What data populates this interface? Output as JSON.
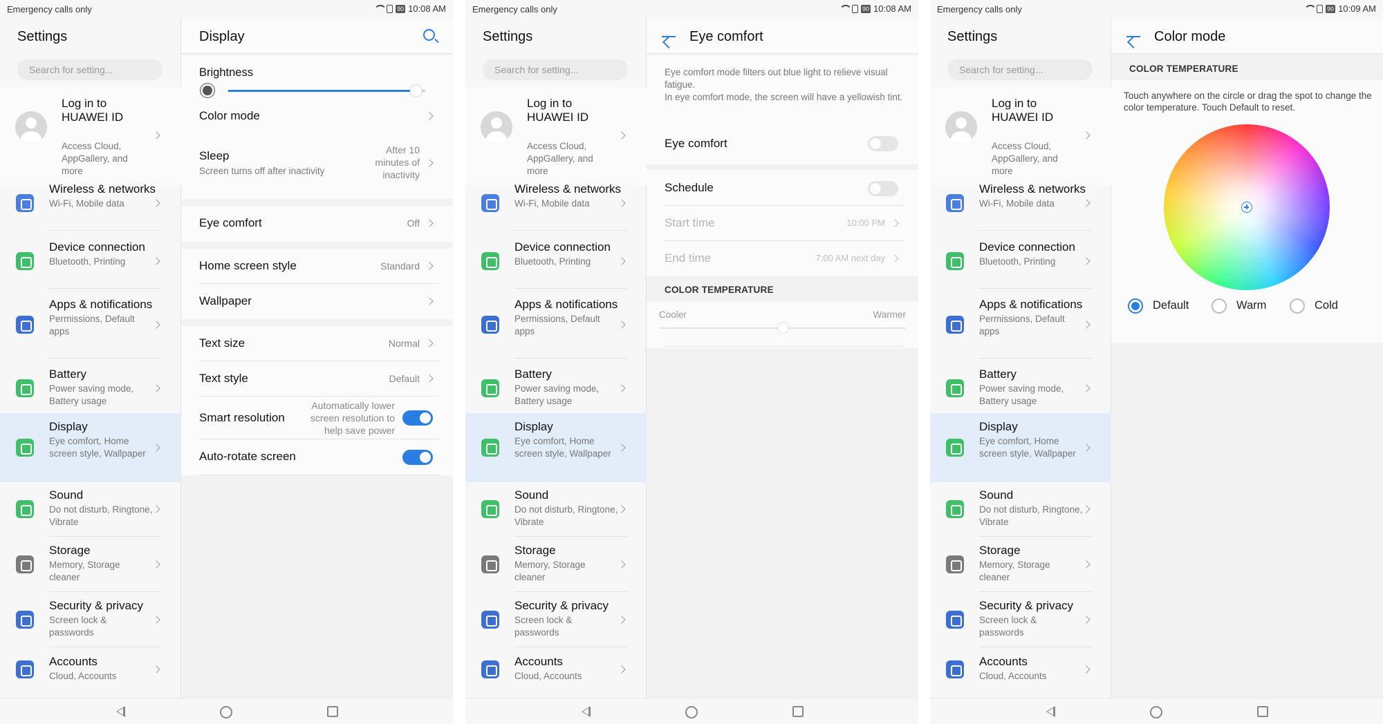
{
  "status": {
    "carrier": "Emergency calls only",
    "battery": "90",
    "time1": "10:08 AM",
    "time2": "10:08 AM",
    "time3": "10:09 AM"
  },
  "nav": {
    "title": "Settings",
    "search_placeholder": "Search for setting...",
    "login_title": "Log in to HUAWEI ID",
    "login_sub": "Access Cloud, AppGallery, and more",
    "items": [
      {
        "title": "Wireless & networks",
        "sub": "Wi-Fi, Mobile data",
        "icon": "wifi-icon"
      },
      {
        "title": "Device connection",
        "sub": "Bluetooth, Printing",
        "icon": "device-connection-icon"
      },
      {
        "title": "Apps & notifications",
        "sub": "Permissions, Default apps",
        "icon": "apps-icon"
      },
      {
        "title": "Battery",
        "sub": "Power saving mode, Battery usage",
        "icon": "battery-icon"
      },
      {
        "title": "Display",
        "sub": "Eye comfort, Home screen style, Wallpaper",
        "icon": "display-icon"
      },
      {
        "title": "Sound",
        "sub": "Do not disturb, Ringtone, Vibrate",
        "icon": "sound-icon"
      },
      {
        "title": "Storage",
        "sub": "Memory, Storage cleaner",
        "icon": "storage-icon"
      },
      {
        "title": "Security & privacy",
        "sub": "Screen lock & passwords",
        "icon": "shield-icon"
      },
      {
        "title": "Accounts",
        "sub": "Cloud, Accounts",
        "icon": "accounts-icon"
      }
    ]
  },
  "display": {
    "title": "Display",
    "brightness": "Brightness",
    "brightness_level": 0.95,
    "color_mode": "Color mode",
    "sleep": "Sleep",
    "sleep_sub": "Screen turns off after inactivity",
    "sleep_value": "After 10 minutes of inactivity",
    "eye_comfort": "Eye comfort",
    "eye_comfort_value": "Off",
    "home_screen_style": "Home screen style",
    "home_screen_style_value": "Standard",
    "wallpaper": "Wallpaper",
    "text_size": "Text size",
    "text_size_value": "Normal",
    "text_style": "Text style",
    "text_style_value": "Default",
    "smart_resolution": "Smart resolution",
    "smart_resolution_value": "Automatically lower screen resolution to help save power",
    "auto_rotate": "Auto-rotate screen"
  },
  "eye": {
    "title": "Eye comfort",
    "description": "Eye comfort mode filters out blue light to relieve visual fatigue.\nIn eye comfort mode, the screen will have a yellowish tint.",
    "eye_comfort": "Eye comfort",
    "schedule": "Schedule",
    "start_time": "Start time",
    "start_time_value": "10:00 PM",
    "end_time": "End time",
    "end_time_value": "7:00 AM next day",
    "color_temp_header": "COLOR TEMPERATURE",
    "cooler": "Cooler",
    "warmer": "Warmer",
    "temp_level": 0.5
  },
  "color": {
    "title": "Color mode",
    "header": "COLOR TEMPERATURE",
    "hint": "Touch anywhere on the circle or drag the spot to change the color temperature. Touch Default to reset.",
    "default": "Default",
    "warm": "Warm",
    "cold": "Cold"
  },
  "colors": {
    "accent": "#2a7de1",
    "selected_nav": "#e3edf9"
  }
}
